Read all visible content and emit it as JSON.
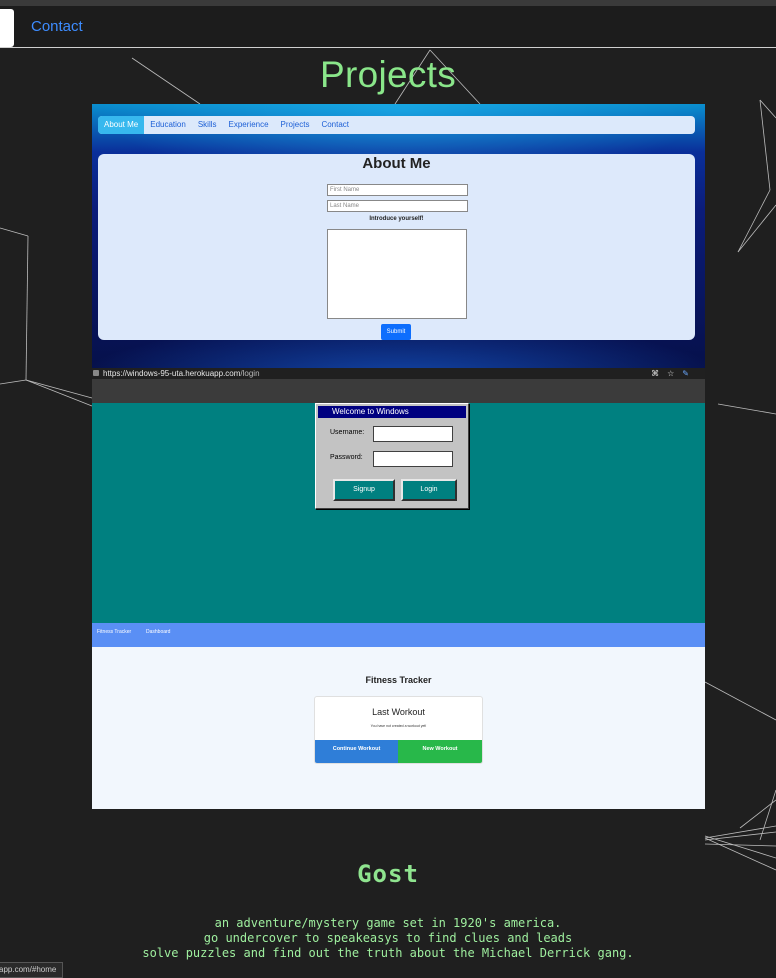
{
  "nav": {
    "contact_label": "Contact"
  },
  "section_title": "Projects",
  "project1": {
    "nav_items": [
      "About Me",
      "Education",
      "Skills",
      "Experience",
      "Projects",
      "Contact"
    ],
    "heading": "About Me",
    "first_name_placeholder": "First Name",
    "last_name_placeholder": "Last Name",
    "intro_label": "Introduce yourself!",
    "submit_label": "Submit"
  },
  "project2": {
    "url_host": "https://windows-95-uta.herokuapp.com",
    "url_path": "/login",
    "window_title": "Welcome to Windows",
    "username_label": "Username:",
    "password_label": "Password:",
    "signup_label": "Signup",
    "login_label": "Login"
  },
  "project3": {
    "nav_items": [
      "Fitness Tracker",
      "Dashboard"
    ],
    "title": "Fitness Tracker",
    "card_heading": "Last Workout",
    "card_subtext": "You have not created a workout yet!",
    "continue_label": "Continue Workout",
    "new_label": "New Workout"
  },
  "gost": {
    "title": "Gost",
    "description_lines": [
      "an adventure/mystery game set in 1920's america.",
      "go undercover to speakeasys to find clues and leads",
      "solve puzzles and find out the truth about the Michael Derrick gang."
    ]
  },
  "status_bar": {
    "text": "app.com/#home"
  },
  "colors": {
    "accent_green": "#8ae68a",
    "link_blue": "#3d8cff",
    "teal": "#008080"
  }
}
